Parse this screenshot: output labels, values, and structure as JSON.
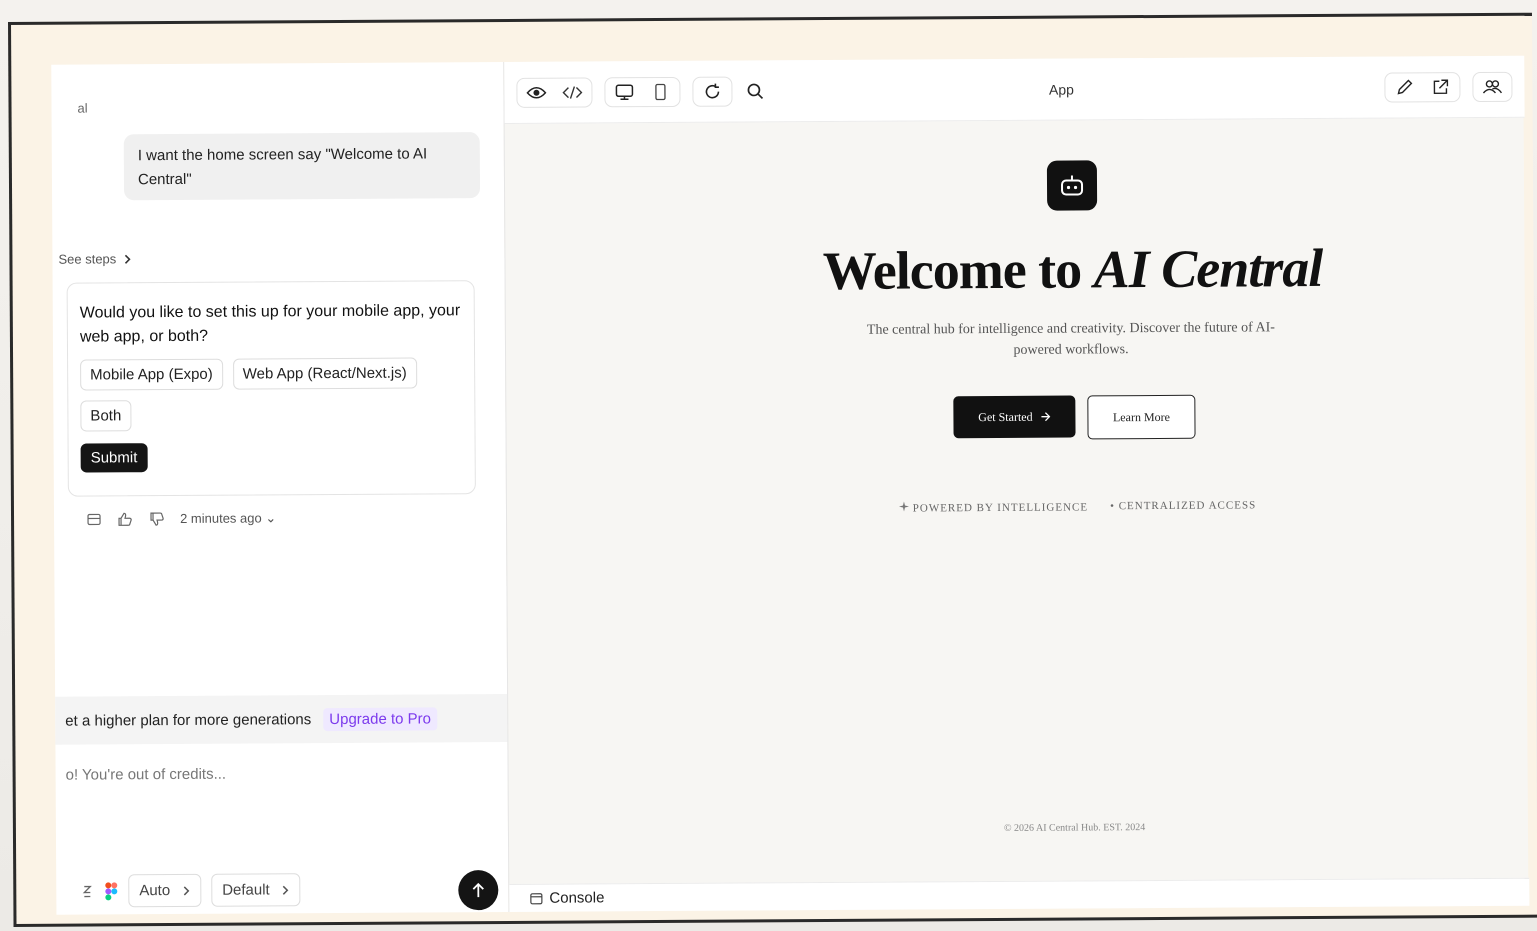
{
  "sidebar": {
    "top_label": "al",
    "user_message": "I want the home screen say \"Welcome to AI Central\"",
    "see_steps": "See steps",
    "question": {
      "text": "Would you like to set this up for your mobile app, your web app, or both?",
      "options": [
        "Mobile App (Expo)",
        "Web App (React/Next.js)",
        "Both"
      ],
      "submit_label": "Submit"
    },
    "timestamp": "2 minutes ago",
    "upgrade": {
      "text": "et a higher plan for more generations",
      "link": "Upgrade to Pro"
    },
    "input_placeholder": "o! You're out of credits...",
    "model_select": "Auto",
    "mode_select": "Default"
  },
  "toolbar": {
    "url": "App"
  },
  "preview": {
    "title_plain": "Welcome to ",
    "title_italic": "AI Central",
    "subtitle": "The central hub for intelligence and creativity. Discover the future of AI-powered workflows.",
    "primary_cta": "Get Started",
    "secondary_cta": "Learn More",
    "feature_1": "POWERED BY INTELLIGENCE",
    "feature_2": "• CENTRALIZED ACCESS",
    "footer": "© 2026 AI Central Hub. EST. 2024"
  },
  "console": {
    "label": "Console"
  },
  "colors": {
    "accent_purple": "#7c3aed",
    "dark": "#111111",
    "frame_bg": "#fbf3e6"
  }
}
